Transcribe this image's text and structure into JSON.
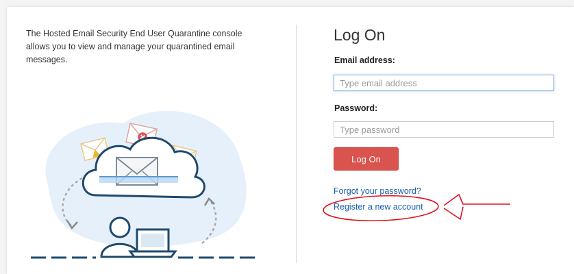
{
  "intro": {
    "text": "The Hosted Email Security End User Quarantine console allows you to view and manage your quarantined email messages."
  },
  "login": {
    "title": "Log On",
    "email_label": "Email address:",
    "email_placeholder": "Type email address",
    "email_value": "",
    "password_label": "Password:",
    "password_placeholder": "Type password",
    "password_value": "",
    "submit_label": "Log On",
    "forgot_link": "Forgot your password?",
    "register_link": "Register a new account"
  },
  "colors": {
    "button": "#d9534f",
    "link": "#1a5fa8",
    "annotation": "#e0111b",
    "illustration_bg": "#e6f0fa",
    "cloud_stroke": "#1e4a6e"
  }
}
